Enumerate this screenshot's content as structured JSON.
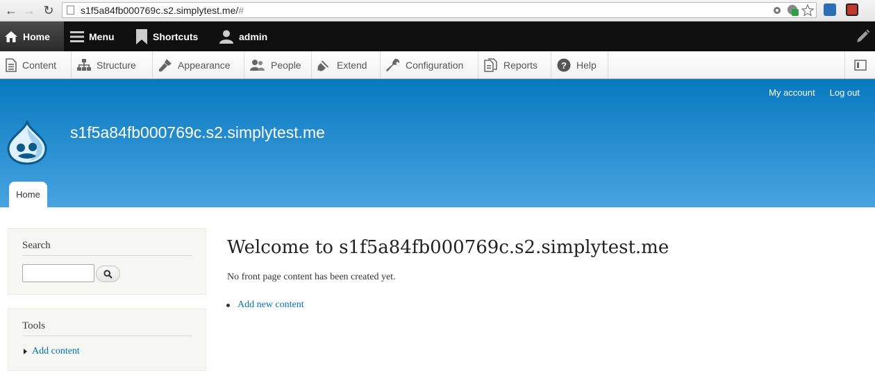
{
  "browser": {
    "url_main": "s1f5a84fb000769c.s2.simplytest.me/",
    "url_hash": "#"
  },
  "toolbar": {
    "home_label": "Home",
    "menu_label": "Menu",
    "shortcuts_label": "Shortcuts",
    "user_label": "admin"
  },
  "admin_menu": {
    "items": [
      {
        "label": "Content",
        "icon": "document-icon"
      },
      {
        "label": "Structure",
        "icon": "sitemap-icon"
      },
      {
        "label": "Appearance",
        "icon": "paintbrush-icon"
      },
      {
        "label": "People",
        "icon": "people-icon"
      },
      {
        "label": "Extend",
        "icon": "plug-icon"
      },
      {
        "label": "Configuration",
        "icon": "wrench-icon"
      },
      {
        "label": "Reports",
        "icon": "reports-icon"
      },
      {
        "label": "Help",
        "icon": "help-icon"
      }
    ]
  },
  "header": {
    "my_account": "My account",
    "log_out": "Log out",
    "site_name": "s1f5a84fb000769c.s2.simplytest.me",
    "tab_home": "Home"
  },
  "sidebar": {
    "search_title": "Search",
    "search_value": "",
    "tools_title": "Tools",
    "tools_link": "Add content"
  },
  "main": {
    "title": "Welcome to s1f5a84fb000769c.s2.simplytest.me",
    "empty_text": "No front page content has been created yet.",
    "add_link": "Add new content"
  },
  "colors": {
    "header_top": "#0779bf",
    "header_bottom": "#48a3e0",
    "link": "#0071b3",
    "toolbar_bg": "#0f0f0f"
  }
}
